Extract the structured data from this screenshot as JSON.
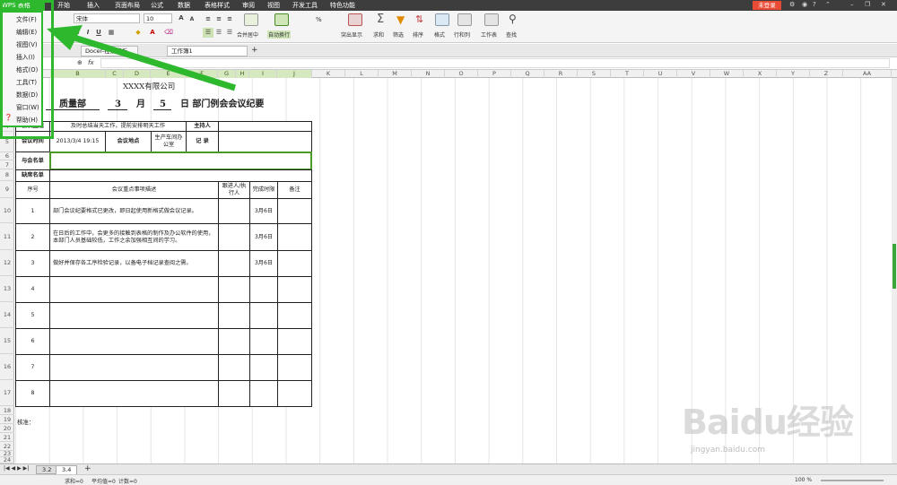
{
  "app": {
    "name": "WPS 表格"
  },
  "menubar": {
    "tabs": [
      "开始",
      "插入",
      "页面布局",
      "公式",
      "数据",
      "表格样式",
      "审阅",
      "视图",
      "开发工具",
      "特色功能"
    ],
    "login": "未登录"
  },
  "dropdown_menu": {
    "items": [
      "文件(F)",
      "编辑(E)",
      "视图(V)",
      "插入(I)",
      "格式(O)",
      "工具(T)",
      "数据(D)",
      "窗口(W)",
      "帮助(H)"
    ]
  },
  "ribbon": {
    "font_name": "宋体",
    "font_size": "10",
    "font_grow": "A",
    "font_shrink": "A",
    "bold": "B",
    "italic": "I",
    "underline": "U",
    "merge_center": "合并居中",
    "auto_wrap": "自动换行",
    "percent": "%",
    "conditional": "突出显示",
    "sum": "求和",
    "filter": "筛选",
    "sort": "排序",
    "format": "格式",
    "row_col": "行和列",
    "worksheet": "工作表",
    "find": "查找"
  },
  "doc_tabs": [
    {
      "label": "Docer-在线模板"
    },
    {
      "label": "工作簿1"
    }
  ],
  "formula_bar": {
    "fx": "fx"
  },
  "columns": [
    "B",
    "C",
    "D",
    "E",
    "F",
    "G",
    "H",
    "I",
    "J",
    "K",
    "L",
    "M",
    "N",
    "O",
    "P",
    "Q",
    "R",
    "S",
    "T",
    "U",
    "V",
    "W",
    "X",
    "Y",
    "Z",
    "AA"
  ],
  "rows": [
    "1",
    "2",
    "3",
    "4",
    "5",
    "6",
    "7",
    "8",
    "9",
    "10",
    "11",
    "12",
    "13",
    "14",
    "15",
    "16",
    "17",
    "18",
    "19",
    "20",
    "21",
    "22",
    "23",
    "24"
  ],
  "document": {
    "company": "XXXX有限公司",
    "dept": "质量部",
    "month_num": "3",
    "month": "月",
    "day_num": "5",
    "title_suffix": "日 部门例会会议纪要",
    "topic_label": "会议主题",
    "topic_value": "及时总结当天工作，提前安排明天工作",
    "host_label": "主持人",
    "host_value": "",
    "time_label": "会议时间",
    "time_value": "2013/3/4 19:15",
    "location_label": "会议地点",
    "location_value": "生产车间办公室",
    "recorder_label": "记  录",
    "recorder_value": "",
    "attendees_label": "与会名单",
    "absent_label": "缺席名单",
    "header_no": "序号",
    "header_content": "会议重点事项描述",
    "header_owner": "跟进人/执行人",
    "header_deadline": "完成时限",
    "header_remark": "备注",
    "items": [
      {
        "no": "1",
        "content": "部门会议纪要格式已更改，即日起使用新格式做会议记录。",
        "deadline": "3月6日"
      },
      {
        "no": "2",
        "content": "在日后的工作中，会更多的接触到表格的制作及办公软件的使用，本部门人员基础较低，工作之余加强相互间的学习。",
        "deadline": "3月6日"
      },
      {
        "no": "3",
        "content": "做好并保存各工序检验记录，以备电子档记录查阅之需。",
        "deadline": "3月6日"
      },
      {
        "no": "4",
        "content": "",
        "deadline": ""
      },
      {
        "no": "5",
        "content": "",
        "deadline": ""
      },
      {
        "no": "6",
        "content": "",
        "deadline": ""
      },
      {
        "no": "7",
        "content": "",
        "deadline": ""
      },
      {
        "no": "8",
        "content": "",
        "deadline": ""
      }
    ],
    "approve_label": "核准："
  },
  "sheet_tabs": [
    "3.2",
    "3.4"
  ],
  "status": {
    "sum": "求和=0",
    "avg": "平均值=0",
    "count": "计数=0",
    "zoom": "100 %"
  },
  "watermark": {
    "main": "Baidu经验",
    "sub": "jingyan.baidu.com"
  },
  "colors": {
    "highlight_green": "#2eb82e",
    "login_red": "#e94b36"
  }
}
